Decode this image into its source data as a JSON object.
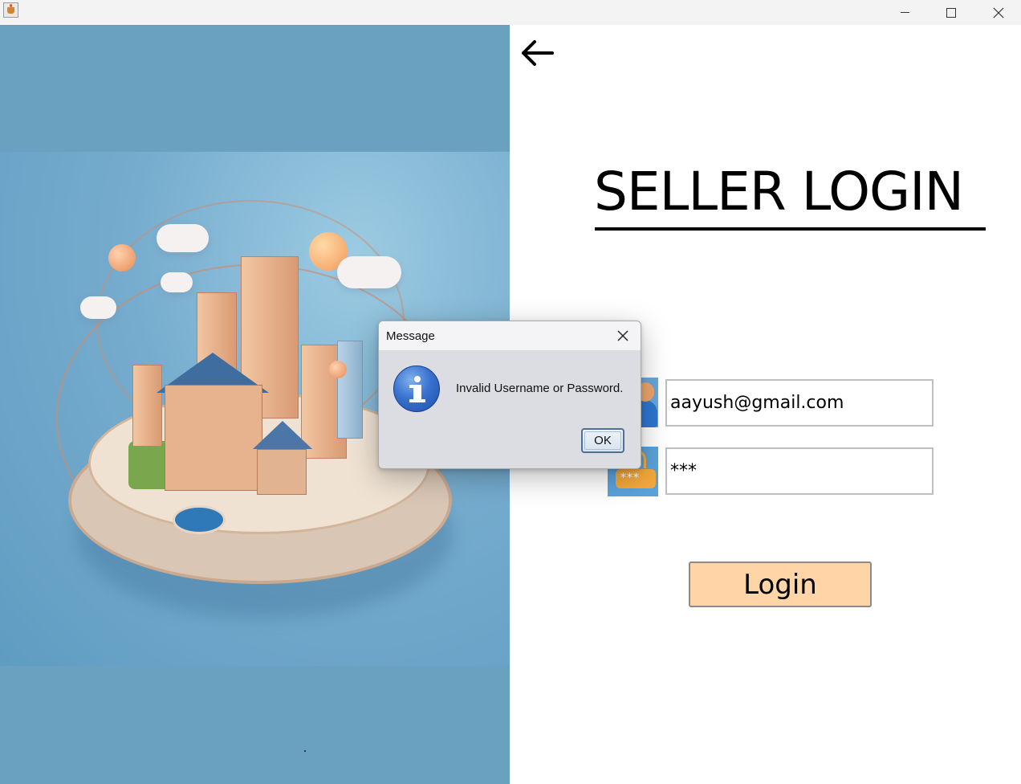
{
  "window": {
    "title": "",
    "controls": {
      "minimize": "minimize-icon",
      "maximize": "maximize-icon",
      "close": "close-icon"
    }
  },
  "image_panel": {
    "subject": "isometric city illustration"
  },
  "header": {
    "back_icon": "arrow-left-icon",
    "title": "SELLER LOGIN"
  },
  "form": {
    "username_icon": "user-icon",
    "username_value": "aayush@gmail.com",
    "password_icon": "password-icon",
    "password_value": "***",
    "password_icon_dots": "***",
    "login_label": "Login",
    "button_color": "#ffd4a6"
  },
  "dialog": {
    "title": "Message",
    "icon": "info-icon",
    "message": "Invalid Username or Password.",
    "ok_label": "OK"
  }
}
